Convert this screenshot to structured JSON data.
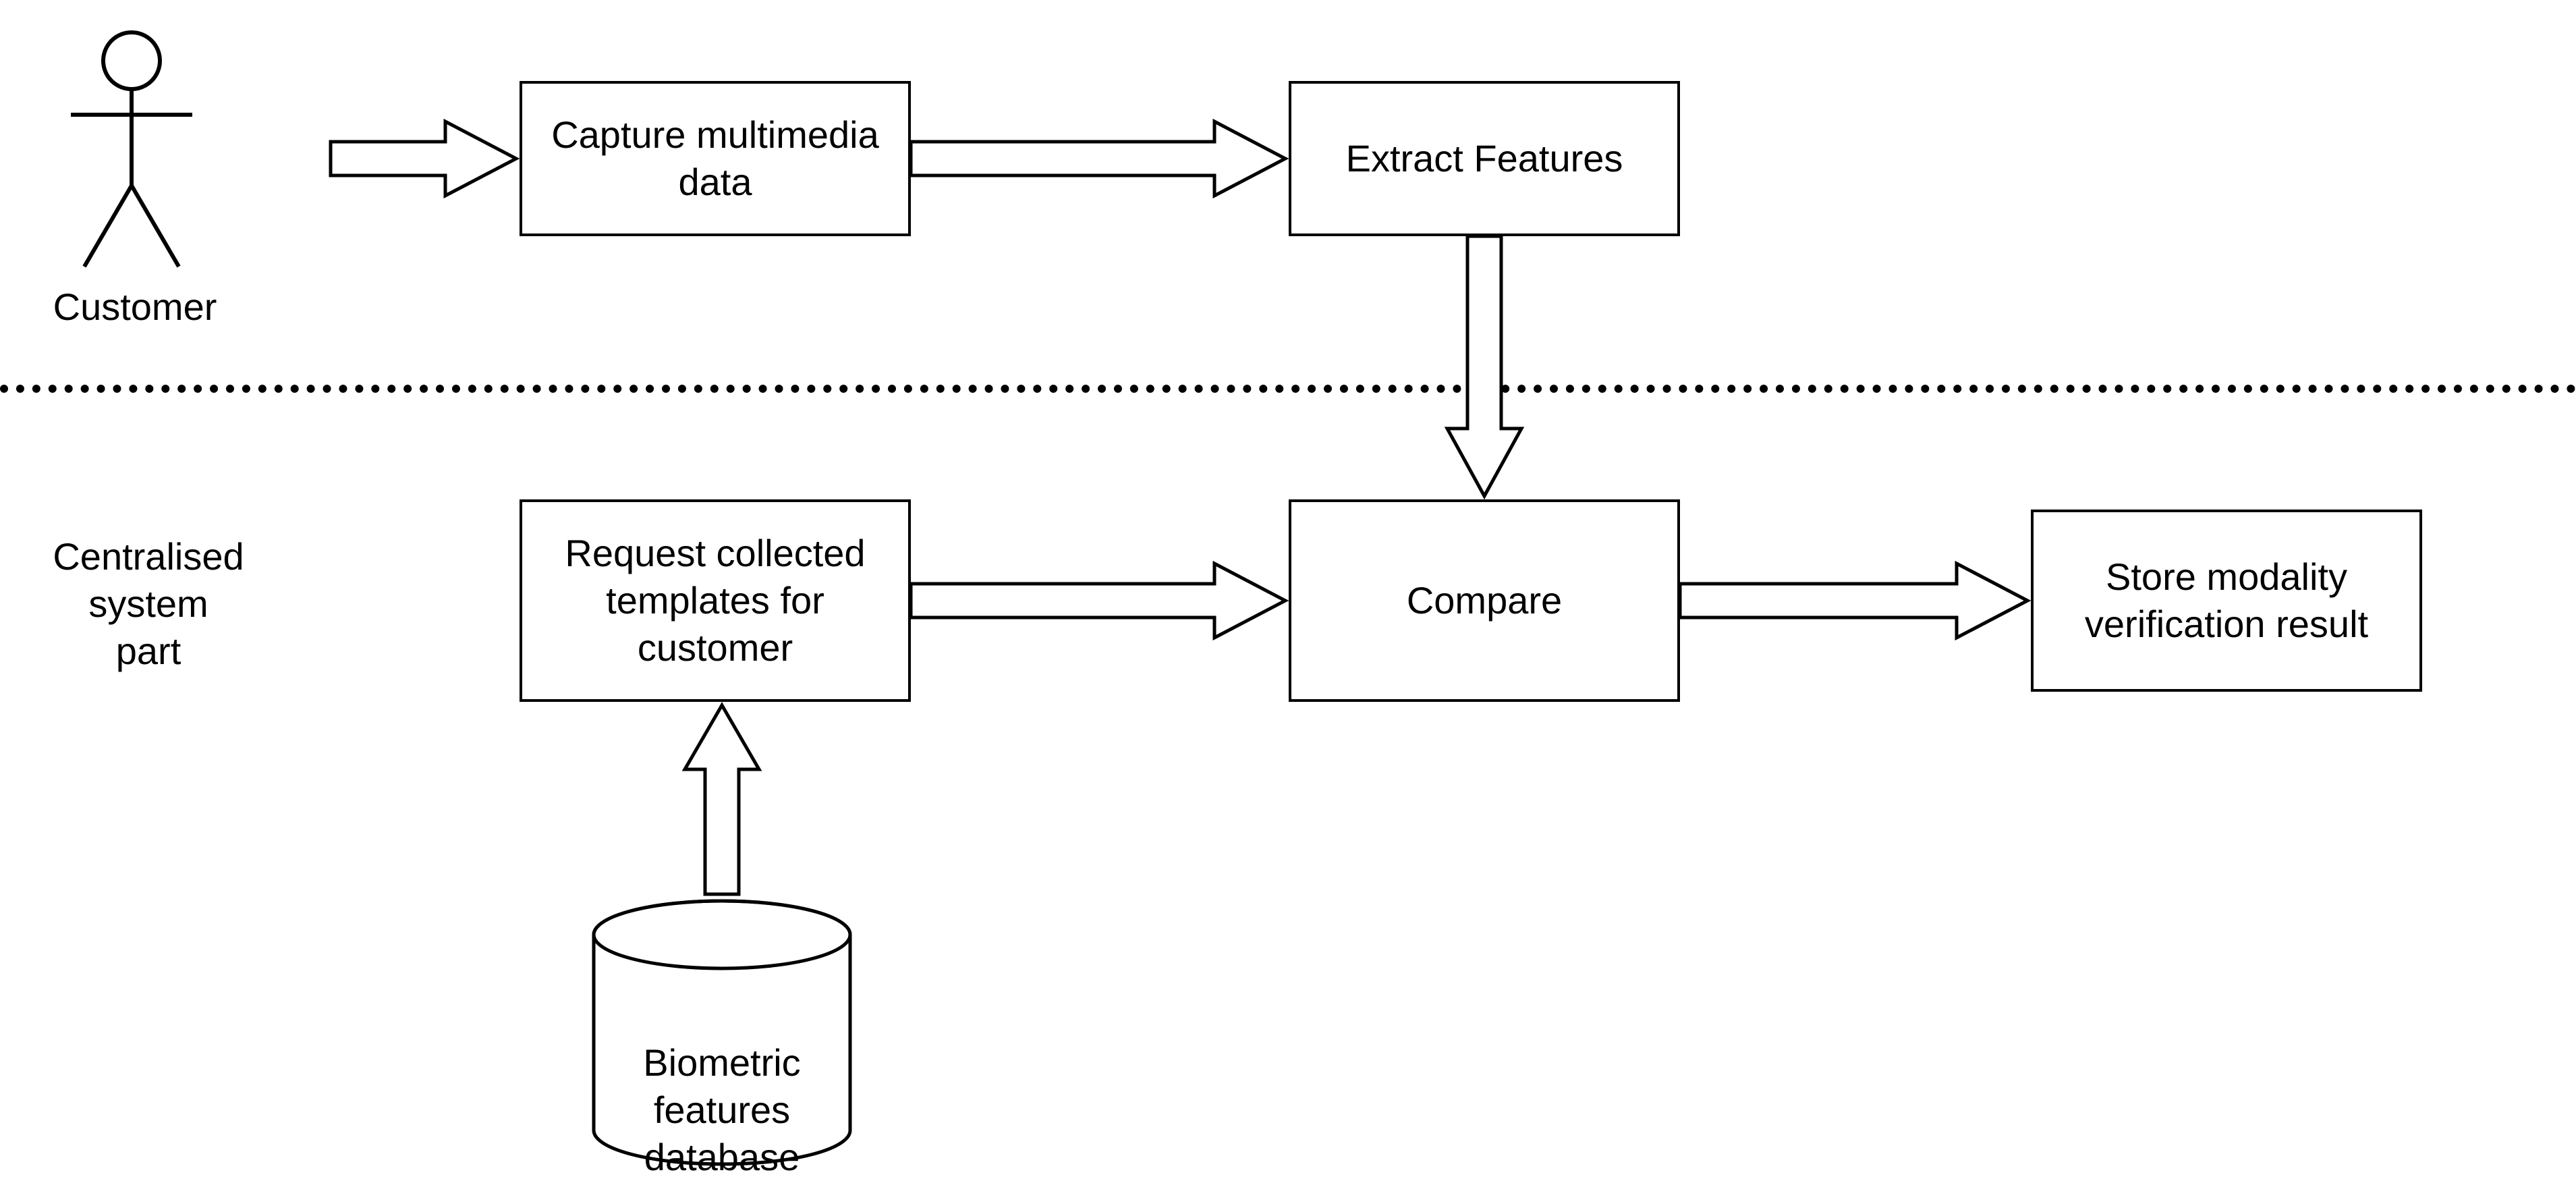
{
  "actor": {
    "label": "Customer"
  },
  "section": {
    "label": "Centralised\nsystem\npart"
  },
  "boxes": {
    "capture": "Capture multimedia\ndata",
    "extract": "Extract Features",
    "request": "Request collected\ntemplates for\ncustomer",
    "compare": "Compare",
    "store": "Store modality\nverification result"
  },
  "database": {
    "label": "Biometric\nfeatures\ndatabase"
  }
}
